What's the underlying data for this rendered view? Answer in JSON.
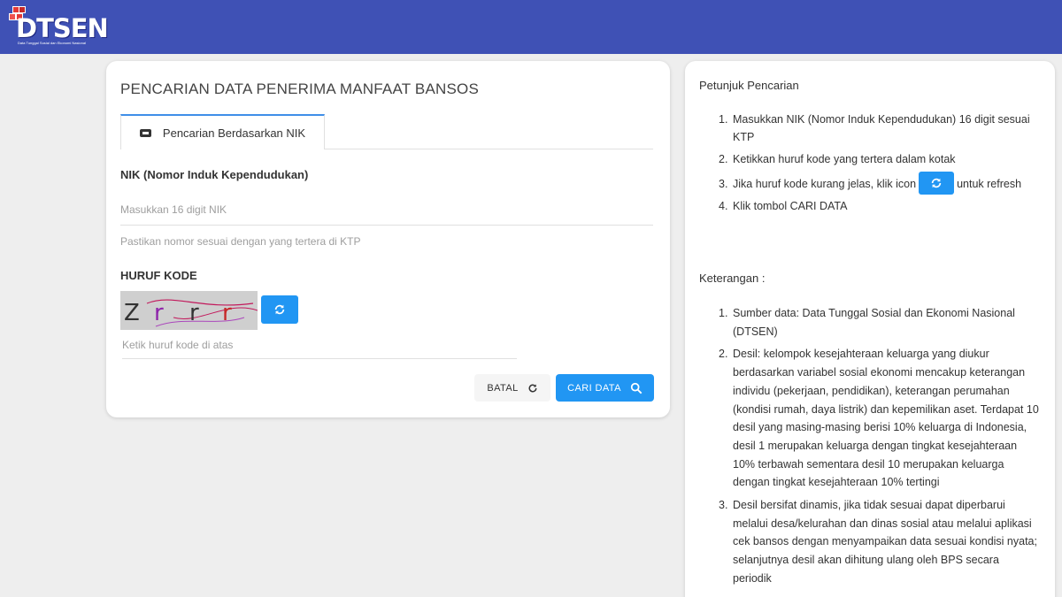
{
  "header": {
    "logo_text": "DTSEN",
    "logo_subtitle": "Data Tunggal Sosial dan Ekonomi Nasional",
    "brand_color": "#3f51b5"
  },
  "search": {
    "title": "PENCARIAN DATA PENERIMA MANFAAT BANSOS",
    "tab_label": "Pencarian Berdasarkan NIK",
    "nik_label": "NIK (Nomor Induk Kependudukan)",
    "nik_placeholder": "Masukkan 16 digit NIK",
    "nik_hint": "Pastikan nomor sesuai dengan yang tertera di KTP",
    "kode_label": "HURUF KODE",
    "captcha_text": "Z r r r",
    "kode_placeholder": "Ketik huruf kode di atas",
    "cancel_label": "BATAL",
    "search_label": "CARI DATA",
    "accent_color": "#2196f3",
    "icons": {
      "tab": "id-card-icon",
      "captcha_refresh": "refresh-icon",
      "cancel": "refresh-icon",
      "search": "search-icon"
    }
  },
  "guide": {
    "title": "Petunjuk Pencarian",
    "steps": [
      "Masukkan NIK (Nomor Induk Kependudukan) 16 digit sesuai KTP",
      "Ketikkan huruf kode yang tertera dalam kotak",
      {
        "before": "Jika huruf kode kurang jelas, klik icon",
        "after": "untuk refresh"
      },
      "Klik tombol CARI DATA"
    ],
    "notes_title": "Keterangan :",
    "notes": [
      "Sumber data: Data Tunggal Sosial dan Ekonomi Nasional (DTSEN)",
      "Desil: kelompok kesejahteraan keluarga yang diukur berdasarkan variabel sosial ekonomi mencakup keterangan individu (pekerjaan, pendidikan), keterangan perumahan (kondisi rumah, daya listrik) dan kepemilikan aset. Terdapat 10 desil yang masing-masing berisi 10% keluarga di Indonesia, desil 1 merupakan keluarga dengan tingkat kesejahteraan 10% terbawah sementara desil 10 merupakan keluarga dengan tingkat kesejahteraan 10% tertingi",
      "Desil bersifat dinamis, jika tidak sesuai dapat diperbarui melalui desa/kelurahan dan dinas sosial atau melalui aplikasi cek bansos dengan menyampaikan data sesuai kondisi nyata; selanjutnya desil akan dihitung ulang oleh BPS secara periodik"
    ]
  }
}
